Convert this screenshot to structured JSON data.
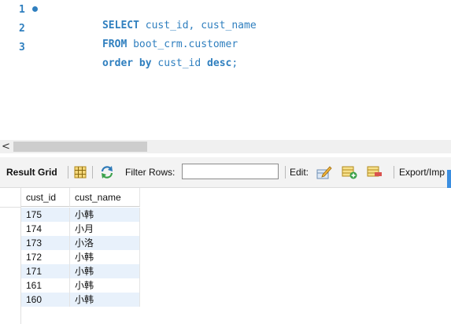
{
  "editor": {
    "lines": [
      {
        "num": "1",
        "kw1": "SELECT",
        "rest1": " cust_id, cust_name",
        "kw2": "",
        "rest2": ""
      },
      {
        "num": "2",
        "kw1": "FROM",
        "rest1": " boot_crm.customer",
        "kw2": "",
        "rest2": ""
      },
      {
        "num": "3",
        "kw1": "order by",
        "rest1": " cust_id ",
        "kw2": "desc",
        "rest2": ";"
      }
    ]
  },
  "scrollbar": {
    "left_arrow": "<"
  },
  "toolbar": {
    "result_grid_label": "Result Grid",
    "filter_rows_label": "Filter Rows:",
    "filter_value": "",
    "edit_label": "Edit:",
    "export_label": "Export/Imp"
  },
  "grid": {
    "columns": [
      "cust_id",
      "cust_name"
    ],
    "rows": [
      [
        "175",
        "小韩"
      ],
      [
        "174",
        "小月"
      ],
      [
        "173",
        "小洛"
      ],
      [
        "172",
        "小韩"
      ],
      [
        "171",
        "小韩"
      ],
      [
        "161",
        "小韩"
      ],
      [
        "160",
        "小韩"
      ]
    ]
  },
  "colors": {
    "keyword": "#2f7fbf",
    "row_alt": "#e8f1fb",
    "toolbar_bg": "#f3f3f3",
    "accent_tab": "#3b8ee0"
  },
  "icons": [
    "grid-form-icon",
    "refresh-icon",
    "edit-pencil-icon",
    "add-row-icon",
    "delete-row-icon"
  ]
}
